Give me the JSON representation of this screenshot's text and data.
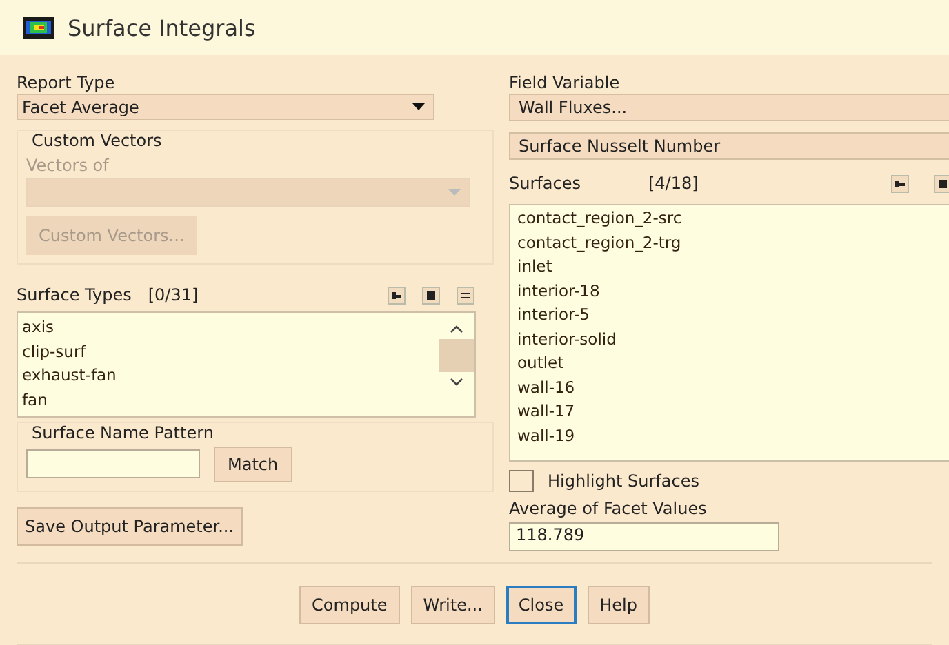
{
  "window": {
    "title": "Surface Integrals"
  },
  "report_type": {
    "label": "Report Type",
    "value": "Facet Average"
  },
  "custom_vectors": {
    "title": "Custom Vectors",
    "vectors_of_label": "Vectors of",
    "button": "Custom Vectors...",
    "disabled": true
  },
  "surface_types": {
    "label": "Surface Types",
    "count": "[0/31]",
    "items": [
      "axis",
      "clip-surf",
      "exhaust-fan",
      "fan"
    ]
  },
  "surface_name_pattern": {
    "title": "Surface Name Pattern",
    "button": "Match"
  },
  "save_button": "Save Output Parameter...",
  "field_variable": {
    "label": "Field Variable",
    "category": "Wall Fluxes...",
    "value": "Surface Nusselt Number"
  },
  "surfaces": {
    "label": "Surfaces",
    "count": "[4/18]",
    "items": [
      "contact_region_2-src",
      "contact_region_2-trg",
      "inlet",
      "interior-18",
      "interior-5",
      "interior-solid",
      "outlet",
      "wall-16",
      "wall-17",
      "wall-19"
    ]
  },
  "highlight_surfaces": {
    "label": "Highlight Surfaces",
    "checked": false
  },
  "result": {
    "label": "Average of Facet Values",
    "value": "118.789"
  },
  "buttons": [
    {
      "label": "Compute",
      "focused": false
    },
    {
      "label": "Write...",
      "focused": false
    },
    {
      "label": "Close",
      "focused": true
    },
    {
      "label": "Help",
      "focused": false
    }
  ]
}
